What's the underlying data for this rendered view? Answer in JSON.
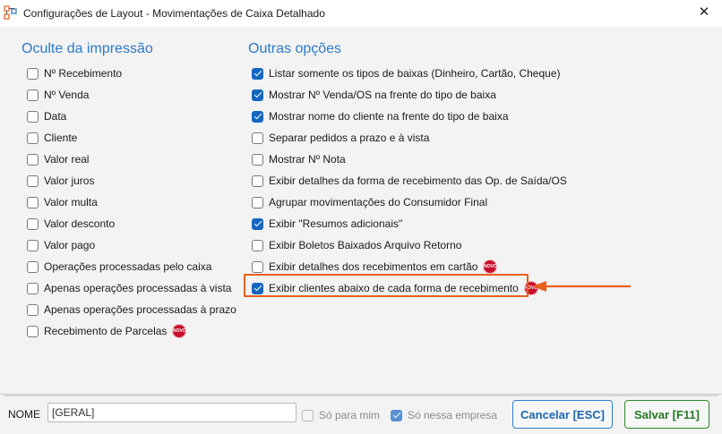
{
  "window": {
    "title": "Configurações de Layout - Movimentações de Caixa Detalhado",
    "close_symbol": "✕"
  },
  "hide_section": {
    "title": "Oculte da impressão",
    "items": [
      {
        "label": "Nº Recebimento",
        "checked": false
      },
      {
        "label": "Nº Venda",
        "checked": false
      },
      {
        "label": "Data",
        "checked": false
      },
      {
        "label": "Cliente",
        "checked": false
      },
      {
        "label": "Valor real",
        "checked": false
      },
      {
        "label": "Valor juros",
        "checked": false
      },
      {
        "label": "Valor multa",
        "checked": false
      },
      {
        "label": "Valor desconto",
        "checked": false
      },
      {
        "label": "Valor pago",
        "checked": false
      },
      {
        "label": "Operações processadas pelo caixa",
        "checked": false
      },
      {
        "label": "Apenas operações processadas à vista",
        "checked": false
      },
      {
        "label": "Apenas operações processadas à prazo",
        "checked": false
      },
      {
        "label": "Recebimento de Parcelas",
        "checked": false,
        "badge": "NOVO"
      }
    ]
  },
  "other_section": {
    "title": "Outras opções",
    "items": [
      {
        "label": "Listar somente os tipos de baixas (Dinheiro, Cartão, Cheque)",
        "checked": true
      },
      {
        "label": "Mostrar Nº Venda/OS na frente do tipo de baixa",
        "checked": true
      },
      {
        "label": "Mostrar nome do cliente na frente do tipo de baixa",
        "checked": true
      },
      {
        "label": "Separar pedidos a prazo e à vista",
        "checked": false
      },
      {
        "label": "Mostrar Nº Nota",
        "checked": false
      },
      {
        "label": "Exibir detalhes da forma de recebimento das Op. de Saída/OS",
        "checked": false
      },
      {
        "label": "Agrupar movimentações do Consumidor Final",
        "checked": false
      },
      {
        "label": "Exibir \"Resumos adicionais\"",
        "checked": true
      },
      {
        "label": "Exibir Boletos Baixados Arquivo Retorno",
        "checked": false
      },
      {
        "label": "Exibir detalhes dos recebimentos em cartão",
        "checked": false,
        "badge": "NOVO"
      },
      {
        "label": "Exibir clientes abaixo de cada forma de recebimento",
        "checked": true,
        "badge": "NOVO",
        "highlighted": true
      }
    ]
  },
  "footer": {
    "nome_label": "NOME",
    "nome_value": "[GERAL]",
    "so_para_mim": {
      "label": "Só para mim",
      "checked": false
    },
    "so_nessa_empresa": {
      "label": "Só nessa empresa",
      "checked": true
    },
    "cancel_label": "Cancelar [ESC]",
    "save_label": "Salvar [F11]"
  },
  "colors": {
    "section_title": "#2e79c4",
    "checkbox_checked": "#1467c0",
    "highlight": "#e8611c",
    "badge": "#c8102e"
  }
}
